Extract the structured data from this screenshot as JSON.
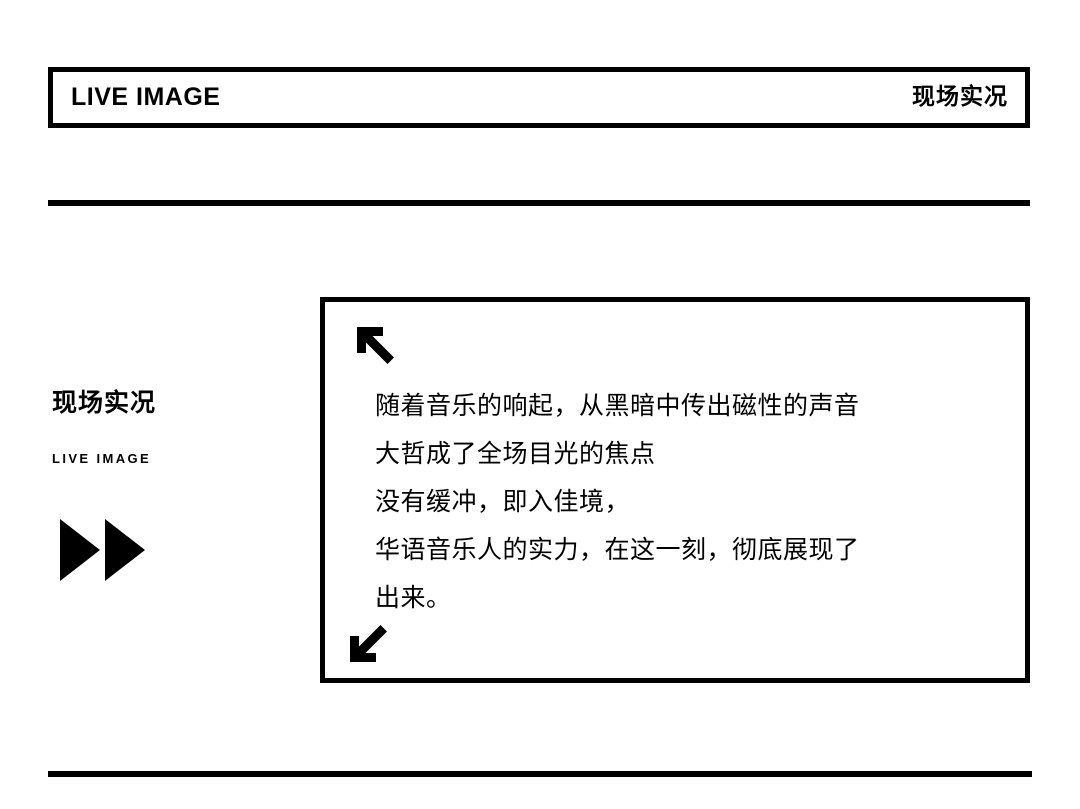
{
  "header": {
    "title": "LIVE IMAGE",
    "subtitle": "现场实况"
  },
  "sidebar": {
    "title": "现场实况",
    "subtitle": "LIVE IMAGE",
    "icon": "fast-forward-icon"
  },
  "content": {
    "arrow_top_left": "arrow-up-left-icon",
    "arrow_bottom_left": "arrow-down-left-icon",
    "lines": [
      "随着音乐的响起，从黑暗中传出磁性的声音",
      "大哲成了全场目光的焦点",
      "没有缓冲，即入佳境，",
      "华语音乐人的实力，在这一刻，彻底展现了",
      "出来。"
    ]
  },
  "colors": {
    "ink": "#000000",
    "background": "#ffffff"
  }
}
